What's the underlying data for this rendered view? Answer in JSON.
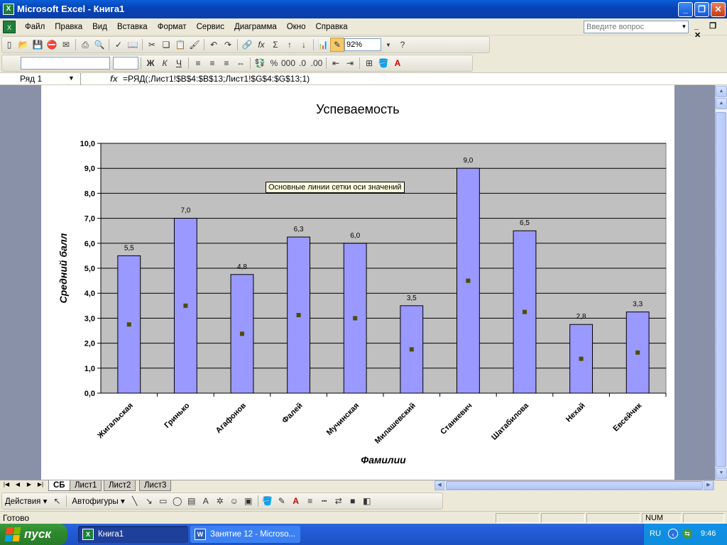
{
  "window": {
    "title": "Microsoft Excel - Книга1",
    "app_icon": "X",
    "buttons": [
      "_",
      "❐",
      "✕"
    ]
  },
  "menu": {
    "items": [
      "Файл",
      "Правка",
      "Вид",
      "Вставка",
      "Формат",
      "Сервис",
      "Диаграмма",
      "Окно",
      "Справка"
    ],
    "help_placeholder": "Введите вопрос"
  },
  "toolbar_std": {
    "zoom": "92%"
  },
  "formula_bar": {
    "name_box": "Ряд 1",
    "fx": "fx",
    "formula": "=РЯД(;Лист1!$B$4:$B$13;Лист1!$G$4:$G$13;1)"
  },
  "tooltip": "Основные линии сетки оси значений",
  "sheet_tabs": {
    "tabs": [
      "СБ",
      "Лист1",
      "Лист2",
      "Лист3"
    ],
    "active": "СБ"
  },
  "drawing_toolbar": {
    "actions_label": "Действия ▾",
    "autoshapes_label": "Автофигуры ▾"
  },
  "status": {
    "text": "Готово",
    "num": "NUM"
  },
  "taskbar": {
    "start_label": "пуск",
    "tasks": [
      {
        "label": "Книга1",
        "icon": "X",
        "active": true
      },
      {
        "label": "Занятие 12 - Microso...",
        "icon": "W",
        "active": false
      }
    ],
    "lang": "RU",
    "clock": "9:46"
  },
  "colors": {
    "bar_fill": "#9999ff",
    "plot_bg": "#c0c0c0",
    "marker": "#4d4d00",
    "grid": "#000000"
  },
  "chart_data": {
    "type": "bar",
    "title": "Успеваемость",
    "xlabel": "Фамилии",
    "ylabel": "Средний балл",
    "ylim": [
      0,
      10
    ],
    "yticks": [
      "0,0",
      "1,0",
      "2,0",
      "3,0",
      "4,0",
      "5,0",
      "6,0",
      "7,0",
      "8,0",
      "9,0",
      "10,0"
    ],
    "categories": [
      "Жигальская",
      "Гринько",
      "Агафонов",
      "Фалей",
      "Мучинская",
      "Милашевский",
      "Станкевич",
      "Шатабилова",
      "Нехай",
      "Евсейчик"
    ],
    "series": [
      {
        "name": "",
        "values": [
          5.5,
          7.0,
          4.75,
          6.25,
          6.0,
          3.5,
          9.0,
          6.5,
          2.75,
          3.25
        ],
        "labels": [
          "5,5",
          "7,0",
          "4,8",
          "6,3",
          "6,0",
          "3,5",
          "9,0",
          "6,5",
          "2,8",
          "3,3"
        ]
      },
      {
        "name": "",
        "type": "marker",
        "values": [
          2.75,
          3.5,
          2.375,
          3.125,
          3.0,
          1.75,
          4.5,
          3.25,
          1.375,
          1.625
        ]
      }
    ],
    "grid": true,
    "legend": "none"
  }
}
